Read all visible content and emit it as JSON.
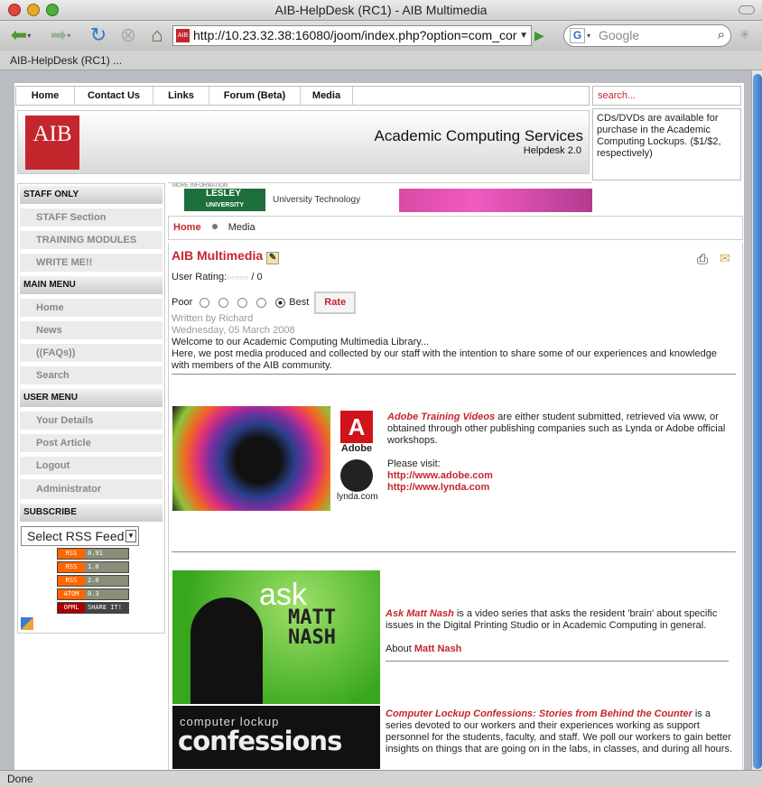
{
  "window": {
    "title": "AIB-HelpDesk (RC1) - AIB Multimedia"
  },
  "browser": {
    "url": "http://10.23.32.38:16080/joom/index.php?option=com_cor",
    "search_placeholder": "Google",
    "tab_label": "AIB-HelpDesk (RC1) ...",
    "status": "Done",
    "favicon_text": "AIB",
    "google_letter": "G"
  },
  "nav": {
    "items": [
      "Home",
      "Contact Us",
      "Links",
      "Forum (Beta)",
      "Media"
    ]
  },
  "search": {
    "placeholder": "search..."
  },
  "header": {
    "logo": "AIB",
    "title": "Academic Computing Services",
    "subtitle": "Helpdesk 2.0"
  },
  "notice": "CDs/DVDs are available for purchase in the Academic Computing Lockups. ($1/$2, respectively)",
  "sidebar": {
    "staff_only": {
      "title": "STAFF ONLY",
      "items": [
        "STAFF Section",
        "TRAINING MODULES",
        "WRITE ME!!"
      ]
    },
    "main_menu": {
      "title": "MAIN MENU",
      "items": [
        "Home",
        "News",
        "((FAQs))",
        "Search"
      ]
    },
    "user_menu": {
      "title": "USER MENU",
      "items": [
        "Your Details",
        "Post Article",
        "Logout",
        "Administrator"
      ]
    },
    "subscribe": {
      "title": "SUBSCRIBE",
      "select_value": "Select RSS Feed",
      "feeds": [
        {
          "type": "RSS",
          "version": "0.91"
        },
        {
          "type": "RSS",
          "version": "1.0"
        },
        {
          "type": "RSS",
          "version": "2.0"
        },
        {
          "type": "ATOM",
          "version": "0.3"
        },
        {
          "type": "OPML",
          "version": "SHARE IT!"
        }
      ]
    }
  },
  "banner": {
    "small": "MORE INFORMATION",
    "lesley": "LESLEY",
    "lesley_sub": "UNIVERSITY",
    "tech": "University Technology"
  },
  "breadcrumb": {
    "home": "Home",
    "current": "Media"
  },
  "article": {
    "title": "AIB Multimedia",
    "rating_label": "User Rating:",
    "rating_value": "/ 0",
    "poor": "Poor",
    "best": "Best",
    "rate_button": "Rate",
    "author": "Written by Richard",
    "date": "Wednesday, 05 March 2008",
    "intro1": "Welcome to our Academic Computing Multimedia Library...",
    "intro2": "Here, we post media produced and collected by our staff with the intention to share some of our experiences and knowledge with members of the AIB community.",
    "adobe": {
      "link": "Adobe Training Videos",
      "text": " are either student submitted, retrieved via www, or obtained through other publishing companies such as Lynda or Adobe official workshops.",
      "visit": "Please visit:",
      "url1": "http://www.adobe.com",
      "url2": "http://www.lynda.com",
      "adobe_logo": "Adobe",
      "lynda_logo": "lynda.com"
    },
    "nash": {
      "link": "Ask Matt Nash",
      "text": " is a video series that asks the resident 'brain' about specific issues in the Digital Printing Studio or in Academic Computing in general.",
      "about": "About",
      "about_link": "Matt Nash",
      "img_ask": "ask",
      "img_name": "MATT NASH"
    },
    "confessions": {
      "link": "Computer Lockup Confessions: Stories from Behind the Counter",
      "text": " is a series devoted to our workers and their experiences working as support personnel for the students, faculty, and staff. We poll our workers to gain better insights on things that are going on in the labs, in classes, and during all hours.",
      "img_top": "computer lockup",
      "img_big": "confessions"
    }
  }
}
